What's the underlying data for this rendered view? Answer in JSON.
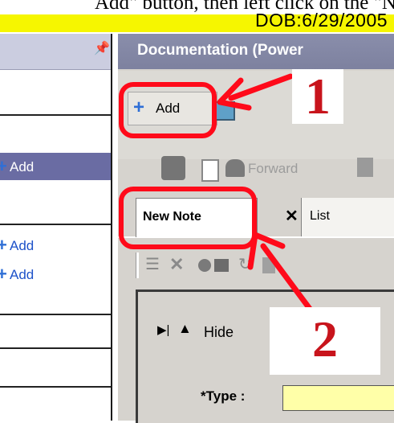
{
  "instruction": {
    "text": "Add\" button, then left click on the \"Ne",
    "dob": "DOB:6/29/2005"
  },
  "left_panel": {
    "pin_icon": "pin-icon",
    "items": [
      {
        "label": "Add",
        "selected": true
      },
      {
        "label": "Add",
        "selected": false
      },
      {
        "label": "Add",
        "selected": false
      }
    ]
  },
  "right_panel": {
    "header_title": "Documentation (Power",
    "toolbar": {
      "add_label": "Add",
      "forward_label": "Forward"
    },
    "tabs": [
      {
        "label": "New Note",
        "active": true
      },
      {
        "label": "List",
        "active": false
      }
    ],
    "form": {
      "hide_label": "Hide",
      "type_label": "*Type :"
    }
  },
  "annotations": {
    "step1": "1",
    "step2": "2"
  },
  "colors": {
    "highlight_yellow": "#f6f600",
    "annotation_red": "#ff0a1a",
    "header_bg": "#7d819f",
    "selected_item": "#6a6ca3",
    "type_field": "#ffffa8"
  }
}
